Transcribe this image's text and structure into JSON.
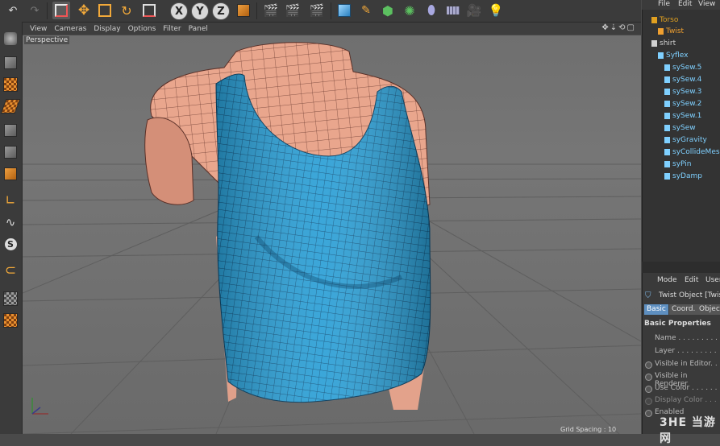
{
  "viewport": {
    "menu": [
      "View",
      "Cameras",
      "Display",
      "Options",
      "Filter",
      "Panel"
    ],
    "camera_label": "Perspective",
    "grid_spacing": "Grid Spacing : 10"
  },
  "axis_buttons": [
    "X",
    "Y",
    "Z"
  ],
  "object_manager": {
    "menu": [
      "File",
      "Edit",
      "View"
    ],
    "tree": [
      {
        "label": "Torso",
        "indent": 1,
        "color": "#e0a020"
      },
      {
        "label": "Twist",
        "indent": 2,
        "color": "#f0a030"
      },
      {
        "label": "shirt",
        "indent": 1,
        "color": "#d0d0d0"
      },
      {
        "label": "Syflex",
        "indent": 2,
        "color": "#7fd0ff"
      },
      {
        "label": "sySew.5",
        "indent": 3,
        "color": "#7fd0ff"
      },
      {
        "label": "sySew.4",
        "indent": 3,
        "color": "#7fd0ff"
      },
      {
        "label": "sySew.3",
        "indent": 3,
        "color": "#7fd0ff"
      },
      {
        "label": "sySew.2",
        "indent": 3,
        "color": "#7fd0ff"
      },
      {
        "label": "sySew.1",
        "indent": 3,
        "color": "#7fd0ff"
      },
      {
        "label": "sySew",
        "indent": 3,
        "color": "#7fd0ff"
      },
      {
        "label": "syGravity",
        "indent": 3,
        "color": "#7fd0ff"
      },
      {
        "label": "syCollideMesh",
        "indent": 3,
        "color": "#7fd0ff"
      },
      {
        "label": "syPin",
        "indent": 3,
        "color": "#7fd0ff"
      },
      {
        "label": "syDamp",
        "indent": 3,
        "color": "#7fd0ff"
      }
    ]
  },
  "attribute_manager": {
    "menu": [
      "Mode",
      "Edit",
      "User"
    ],
    "object_title": "Twist Object [Twist]",
    "tabs": [
      "Basic",
      "Coord.",
      "Object"
    ],
    "section": "Basic Properties",
    "rows": [
      "Name . . . . . . . . .",
      "Layer . . . . . . . . .",
      "Visible in Editor. . .",
      "Visible in Renderer",
      "Use Color . . . . . .",
      "Display Color . . .",
      "Enabled"
    ]
  },
  "watermark": "3HE 当游网",
  "colors": {
    "shirt": "#2a9fd6",
    "skin": "#e7a58c",
    "accent": "#4aa8e8"
  }
}
